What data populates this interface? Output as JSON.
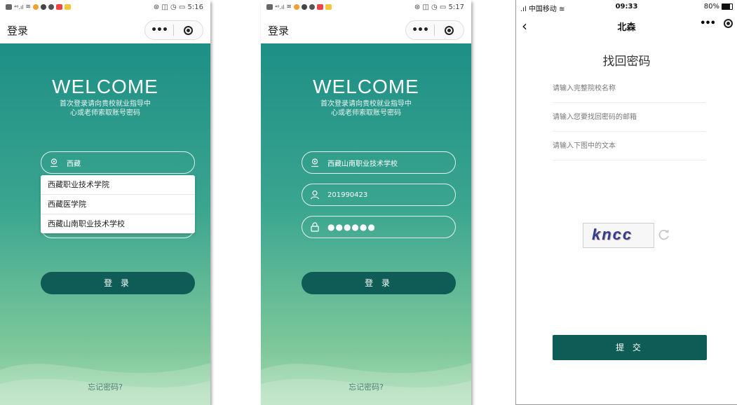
{
  "phone1": {
    "status_time": "5:16",
    "nav_title": "登录",
    "welcome": "WELCOME",
    "subtitle_line1": "首次登录请向贵校就业指导中",
    "subtitle_line2": "心或老师索取账号密码",
    "school_input_value": "西藏",
    "dropdown_options": [
      "西藏职业技术学院",
      "西藏医学院",
      "西藏山南职业技术学校"
    ],
    "login_label": "登 录",
    "forgot_label": "忘记密码?"
  },
  "phone2": {
    "status_time": "5:17",
    "nav_title": "登录",
    "welcome": "WELCOME",
    "subtitle_line1": "首次登录请向贵校就业指导中",
    "subtitle_line2": "心或老师索取账号密码",
    "school_value": "西藏山南职业技术学校",
    "account_value": "201990423",
    "password_value": "●●●●●●",
    "login_label": "登 录",
    "forgot_label": "忘记密码?"
  },
  "phone3": {
    "carrier": "中国移动",
    "time": "09:33",
    "battery": "80%",
    "battery_level": 0.8,
    "nav_title": "北森",
    "heading": "找回密码",
    "school_placeholder": "请输入完整院校名称",
    "email_placeholder": "请输入您要找回密码的邮箱",
    "captcha_placeholder": "请输入下图中的文本",
    "captcha_text": "kncc",
    "submit_label": "提 交"
  },
  "colors": {
    "teal_top": "#1e8f86",
    "teal_bottom": "#a9dcb3",
    "button": "#0e5c55"
  }
}
